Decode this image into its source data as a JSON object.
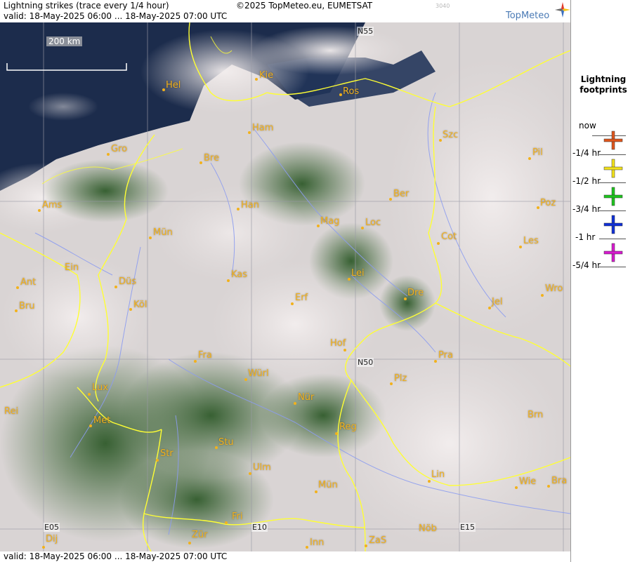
{
  "header": {
    "title": "Lightning strikes (trace every 1/4 hour)",
    "copyright": "©2025 TopMeteo.eu, EUMETSAT",
    "valid": "valid:  18-May-2025 06:00 ... 18-May-2025 07:00 UTC",
    "code": "3040",
    "brand": "TopMeteo"
  },
  "footer": {
    "valid": "valid:  18-May-2025 06:00 ... 18-May-2025 07:00 UTC"
  },
  "map": {
    "scale_label": "200 km",
    "grid_labels": [
      "N55",
      "N50",
      "E05",
      "E10",
      "E15"
    ],
    "cities": [
      "Hel",
      "Kie",
      "Ros",
      "Ham",
      "Szc",
      "Gro",
      "Bre",
      "Pil",
      "Ber",
      "Ams",
      "Han",
      "Poz",
      "Mag",
      "Loc",
      "Mün",
      "Cot",
      "Les",
      "Ein",
      "Lei",
      "Kas",
      "Ant",
      "Düs",
      "Wro",
      "Erf",
      "Dre",
      "Bru",
      "Köl",
      "Jel",
      "Hof",
      "Fra",
      "Pra",
      "Würl",
      "Plz",
      "Lux",
      "Nür",
      "Rei",
      "Brn",
      "Met",
      "Reg",
      "Stu",
      "Str",
      "Ulm",
      "Lin",
      "Wie",
      "Bra",
      "Mün",
      "Fri",
      "Nöb",
      "Zür",
      "Dij",
      "Inn",
      "ZaS"
    ]
  },
  "legend": {
    "title_line1": "Lightning",
    "title_line2": "footprints",
    "items": [
      {
        "label": "now",
        "color": ""
      },
      {
        "label": "-1/4 hr",
        "color": "#e0561c"
      },
      {
        "label": "-1/2 hr",
        "color": "#f2e21a"
      },
      {
        "label": "-3/4 hr",
        "color": "#1ec41e"
      },
      {
        "label": "-1 hr",
        "color": "#1030d8"
      },
      {
        "label": "-5/4 hr",
        "color": "#d81ad0"
      }
    ]
  },
  "colors": {
    "city": "#f2b11c",
    "border": "#ffff33",
    "river": "#8c9cf0",
    "sea": "#1c2c4c"
  }
}
